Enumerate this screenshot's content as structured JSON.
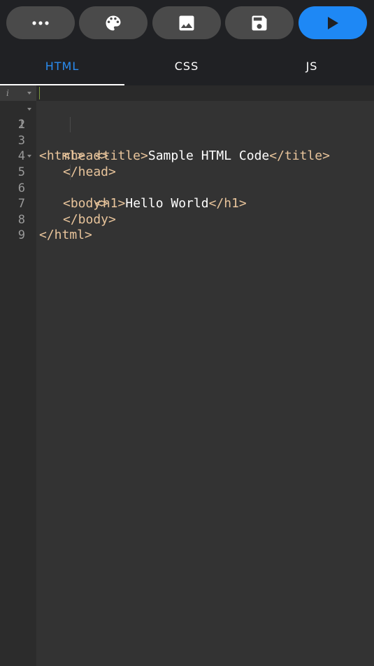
{
  "toolbar": {
    "buttons": [
      {
        "name": "more-button",
        "icon": "more-dots-icon"
      },
      {
        "name": "theme-button",
        "icon": "palette-icon"
      },
      {
        "name": "image-button",
        "icon": "image-icon"
      },
      {
        "name": "save-button",
        "icon": "floppy-disk-icon"
      },
      {
        "name": "run-button",
        "icon": "play-icon"
      }
    ],
    "accent_color": "#1e88f5"
  },
  "tabs": [
    {
      "label": "HTML",
      "active": true
    },
    {
      "label": "CSS",
      "active": false
    },
    {
      "label": "JS",
      "active": false
    }
  ],
  "editor": {
    "info_marker": "i",
    "lines": [
      {
        "num": "1",
        "parts": [
          {
            "t": "tag",
            "v": "<html>"
          }
        ]
      },
      {
        "num": "2",
        "parts": [
          {
            "t": "tag",
            "v": "<head>"
          }
        ]
      },
      {
        "num": "3",
        "parts": [
          {
            "t": "tag",
            "v": "<title>"
          },
          {
            "t": "txt",
            "v": "Sample HTML Code"
          },
          {
            "t": "tag",
            "v": "</title>"
          }
        ]
      },
      {
        "num": "4",
        "parts": [
          {
            "t": "tag",
            "v": "</head>"
          }
        ]
      },
      {
        "num": "5",
        "parts": [
          {
            "t": "tag",
            "v": "<body>"
          }
        ]
      },
      {
        "num": "6",
        "parts": [
          {
            "t": "tag",
            "v": "<h1>"
          },
          {
            "t": "txt",
            "v": "Hello World"
          },
          {
            "t": "tag",
            "v": "</h1>"
          }
        ]
      },
      {
        "num": "7",
        "parts": [
          {
            "t": "tag",
            "v": "</body>"
          }
        ]
      },
      {
        "num": "8",
        "parts": [
          {
            "t": "tag",
            "v": "</html>"
          }
        ]
      },
      {
        "num": "9",
        "parts": []
      }
    ],
    "tag_color": "#e8c49b",
    "text_color": "#ffffff"
  }
}
